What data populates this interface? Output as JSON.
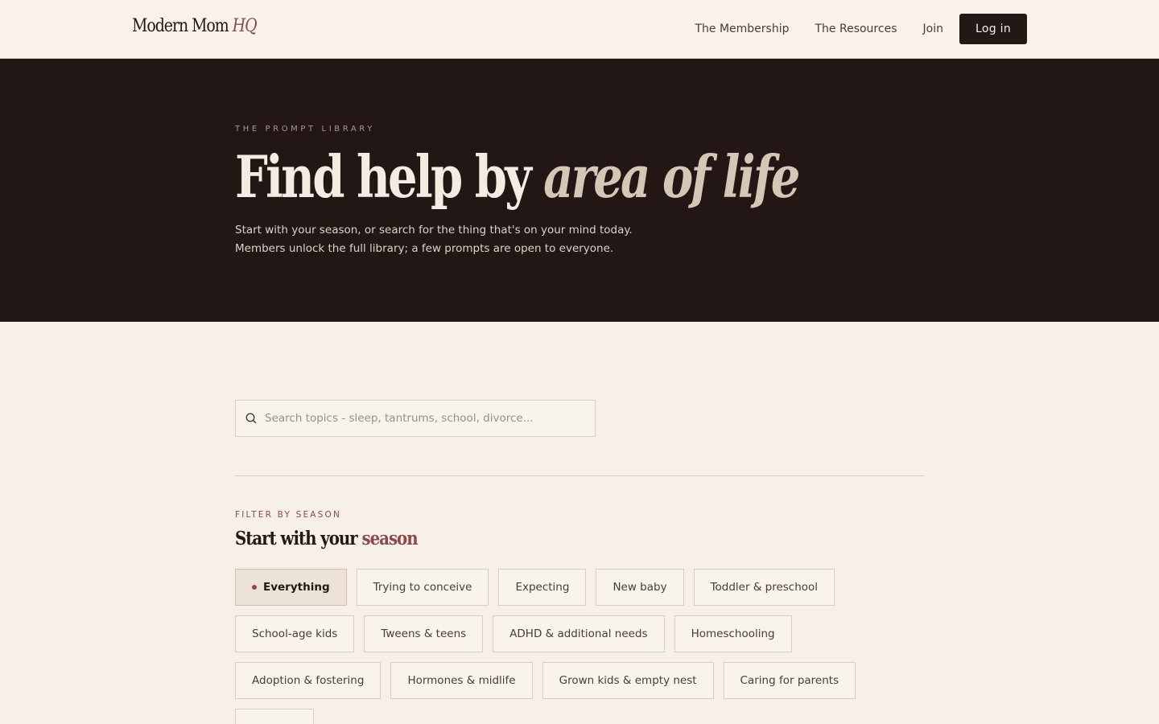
{
  "header": {
    "logo_main": "Modern Mom",
    "logo_accent": "HQ",
    "nav": [
      "The Membership",
      "The Resources",
      "Join"
    ],
    "login_label": "Log in"
  },
  "hero": {
    "eyebrow": "THE PROMPT LIBRARY",
    "title_plain": "Find help by",
    "title_italic": "area of life",
    "subtitle_line1": "Start with your season, or search for the thing that's on your mind today.",
    "subtitle_line2": "Members unlock the full library; a few prompts are open to everyone."
  },
  "search": {
    "placeholder": "Search topics - sleep, tantrums, school, divorce...",
    "icon": "search-icon"
  },
  "filter": {
    "eyebrow": "FILTER BY SEASON",
    "title_plain": "Start with your",
    "title_accent": "season",
    "chips": [
      {
        "label": "Everything",
        "active": true
      },
      {
        "label": "Trying to conceive",
        "active": false
      },
      {
        "label": "Expecting",
        "active": false
      },
      {
        "label": "New baby",
        "active": false
      },
      {
        "label": "Toddler & preschool",
        "active": false
      },
      {
        "label": "School-age kids",
        "active": false
      },
      {
        "label": "Tweens & teens",
        "active": false
      },
      {
        "label": "ADHD & additional needs",
        "active": false
      },
      {
        "label": "Homeschooling",
        "active": false
      },
      {
        "label": "Adoption & fostering",
        "active": false
      },
      {
        "label": "Hormones & midlife",
        "active": false
      },
      {
        "label": "Grown kids & empty nest",
        "active": false
      },
      {
        "label": "Caring for parents",
        "active": false
      },
      {
        "label": "",
        "active": false
      }
    ]
  },
  "colors": {
    "background": "#f6f0e8",
    "hero_bg": "#221715",
    "accent": "#8b4a4a",
    "ink": "#231815"
  }
}
